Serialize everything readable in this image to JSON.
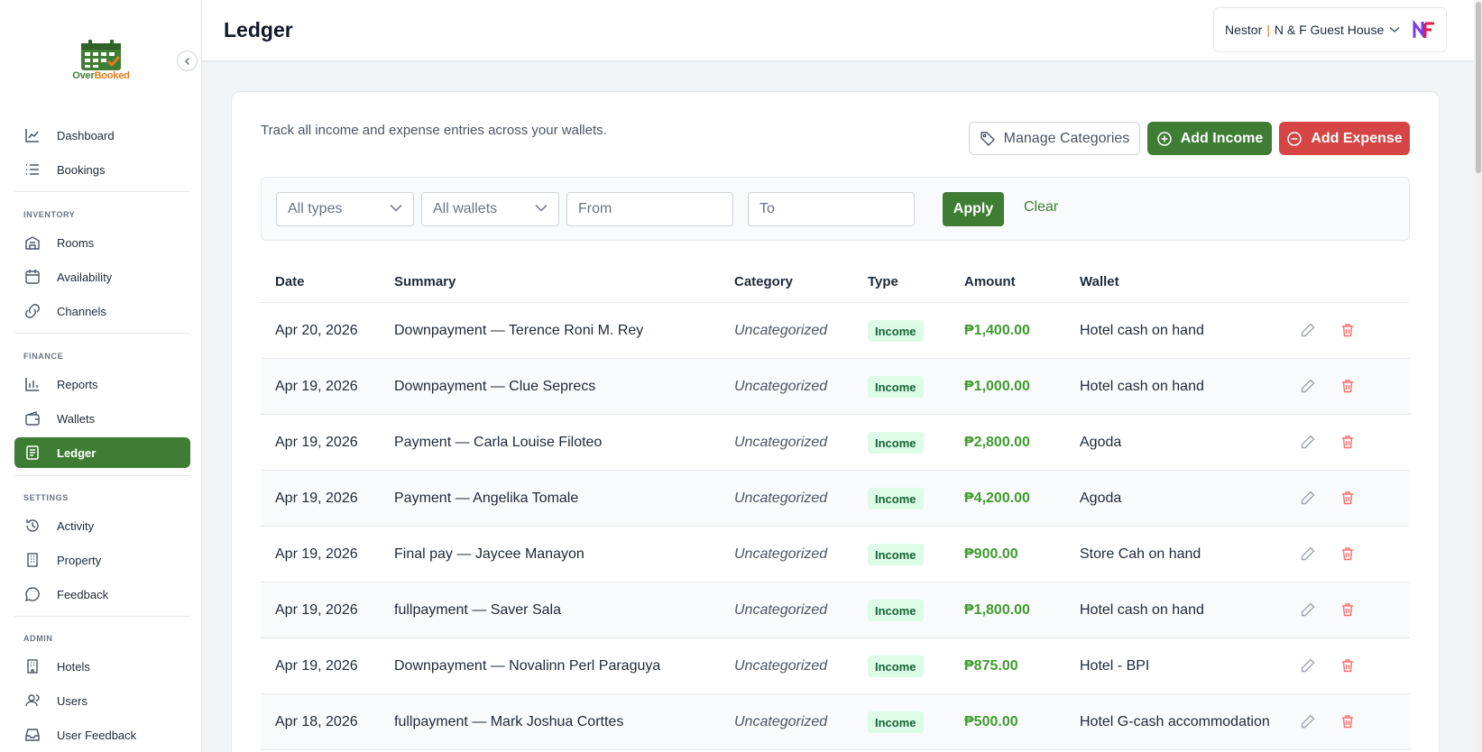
{
  "app": {
    "logo_text_1": "Over",
    "logo_text_2": "Booked"
  },
  "sidebar": {
    "main": [
      {
        "label": "Dashboard",
        "icon": "chart-line-icon"
      },
      {
        "label": "Bookings",
        "icon": "list-icon"
      }
    ],
    "inventory_title": "INVENTORY",
    "inventory": [
      {
        "label": "Rooms",
        "icon": "building-icon"
      },
      {
        "label": "Availability",
        "icon": "calendar-icon"
      },
      {
        "label": "Channels",
        "icon": "link-icon"
      }
    ],
    "finance_title": "FINANCE",
    "finance": [
      {
        "label": "Reports",
        "icon": "bar-chart-icon"
      },
      {
        "label": "Wallets",
        "icon": "wallet-icon"
      },
      {
        "label": "Ledger",
        "icon": "ledger-icon",
        "active": true
      }
    ],
    "settings_title": "SETTINGS",
    "settings": [
      {
        "label": "Activity",
        "icon": "history-icon"
      },
      {
        "label": "Property",
        "icon": "property-icon"
      },
      {
        "label": "Feedback",
        "icon": "chat-icon"
      }
    ],
    "admin_title": "ADMIN",
    "admin": [
      {
        "label": "Hotels",
        "icon": "hotel-icon"
      },
      {
        "label": "Users",
        "icon": "users-icon"
      },
      {
        "label": "User Feedback",
        "icon": "inbox-icon"
      }
    ]
  },
  "header": {
    "title": "Ledger",
    "user_name": "Nestor",
    "separator": "|",
    "property": "N & F Guest House"
  },
  "toolbar": {
    "subtitle": "Track all income and expense entries across your wallets.",
    "manage_categories": "Manage Categories",
    "add_income": "Add Income",
    "add_expense": "Add Expense"
  },
  "filters": {
    "type_value": "All types",
    "wallet_value": "All wallets",
    "from_placeholder": "From",
    "to_placeholder": "To",
    "apply": "Apply",
    "clear": "Clear"
  },
  "table": {
    "headers": {
      "date": "Date",
      "summary": "Summary",
      "category": "Category",
      "type": "Type",
      "amount": "Amount",
      "wallet": "Wallet"
    },
    "rows": [
      {
        "date": "Apr 20, 2026",
        "summary": "Downpayment — Terence Roni M. Rey",
        "category": "Uncategorized",
        "type": "Income",
        "amount": "₱1,400.00",
        "wallet": "Hotel cash on hand"
      },
      {
        "date": "Apr 19, 2026",
        "summary": "Downpayment — Clue Seprecs",
        "category": "Uncategorized",
        "type": "Income",
        "amount": "₱1,000.00",
        "wallet": "Hotel cash on hand"
      },
      {
        "date": "Apr 19, 2026",
        "summary": "Payment — Carla Louise Filoteo",
        "category": "Uncategorized",
        "type": "Income",
        "amount": "₱2,800.00",
        "wallet": "Agoda"
      },
      {
        "date": "Apr 19, 2026",
        "summary": "Payment — Angelika Tomale",
        "category": "Uncategorized",
        "type": "Income",
        "amount": "₱4,200.00",
        "wallet": "Agoda"
      },
      {
        "date": "Apr 19, 2026",
        "summary": "Final pay — Jaycee Manayon",
        "category": "Uncategorized",
        "type": "Income",
        "amount": "₱900.00",
        "wallet": "Store Cah on hand"
      },
      {
        "date": "Apr 19, 2026",
        "summary": "fullpayment — Saver Sala",
        "category": "Uncategorized",
        "type": "Income",
        "amount": "₱1,800.00",
        "wallet": "Hotel cash on hand"
      },
      {
        "date": "Apr 19, 2026",
        "summary": "Downpayment — Novalinn Perl Paraguya",
        "category": "Uncategorized",
        "type": "Income",
        "amount": "₱875.00",
        "wallet": "Hotel - BPI"
      },
      {
        "date": "Apr 18, 2026",
        "summary": "fullpayment — Mark Joshua Corttes",
        "category": "Uncategorized",
        "type": "Income",
        "amount": "₱500.00",
        "wallet": "Hotel G-cash accommodation"
      }
    ]
  },
  "colors": {
    "brand_green": "#3f7d35",
    "danger_red": "#d64545",
    "income_text": "#3f9b2f"
  }
}
